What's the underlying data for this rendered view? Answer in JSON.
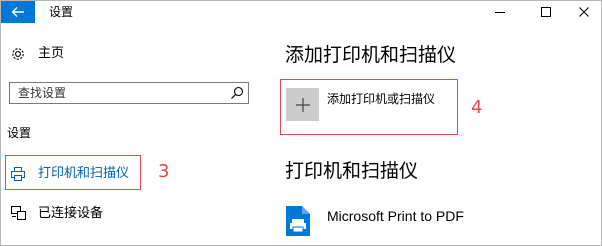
{
  "window": {
    "title": "设置"
  },
  "sidebar": {
    "home_label": "主页",
    "search": {
      "placeholder": "查找设置"
    },
    "section_label": "设置",
    "items": [
      {
        "label": "打印机和扫描仪",
        "icon": "printer-icon",
        "selected": true
      },
      {
        "label": "已连接设备",
        "icon": "devices-icon",
        "selected": false
      }
    ]
  },
  "main": {
    "add_heading": "添加打印机和扫描仪",
    "add_button_label": "添加打印机或扫描仪",
    "list_heading": "打印机和扫描仪",
    "printers": [
      {
        "name": "Microsoft Print to PDF",
        "icon": "pdf-printer-icon"
      }
    ]
  },
  "annotations": {
    "step_3": "3",
    "step_4": "4"
  },
  "colors": {
    "accent": "#0078d7",
    "selected_text": "#0063b1",
    "annotation_red": "#e14b4b",
    "tile_gray": "#cccccc"
  }
}
